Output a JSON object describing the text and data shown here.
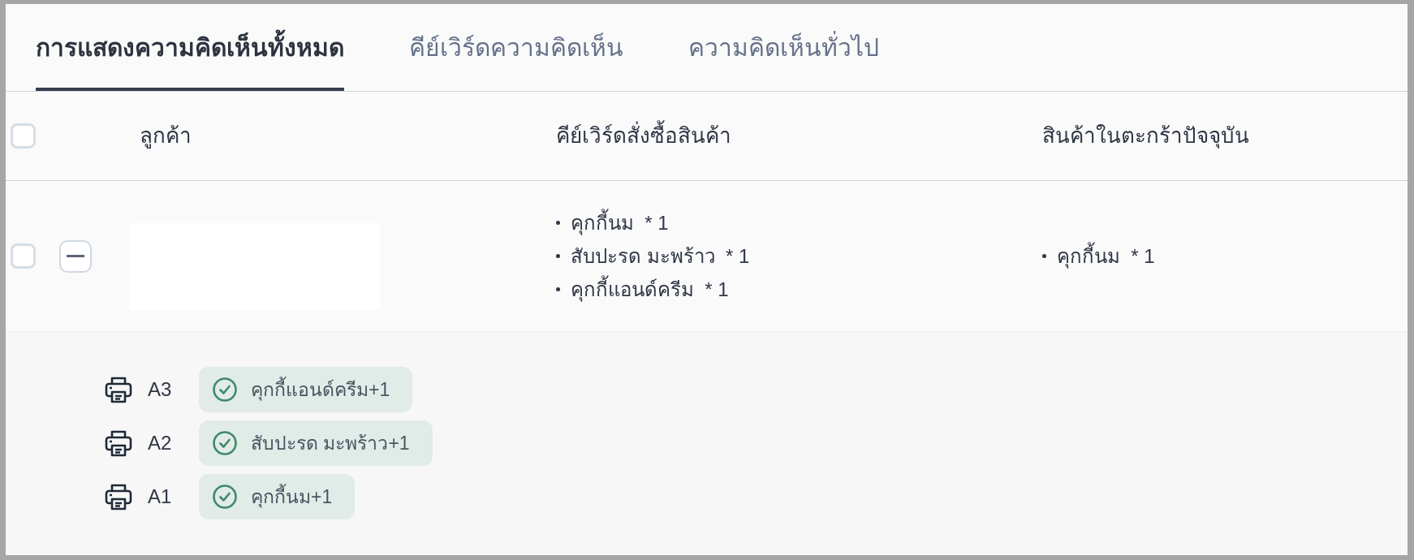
{
  "tabs": [
    {
      "label": "การแสดงความคิดเห็นทั้งหมด",
      "selected": true
    },
    {
      "label": "คีย์เวิร์ดความคิดเห็น",
      "selected": false
    },
    {
      "label": "ความคิดเห็นทั่วไป",
      "selected": false
    }
  ],
  "table": {
    "select_all": {
      "checked": false
    },
    "columns": [
      "ลูกค้า",
      "คีย์เวิร์ดสั่งซื้อสินค้า",
      "สินค้าในตะกร้าปัจจุบัน"
    ],
    "rows": [
      {
        "checked": false,
        "expanded": true,
        "order_keywords": [
          "คุกกี้นม  * 1",
          "สับปะรด มะพร้าว  * 1",
          "คุกกี้แอนด์ครีม  * 1"
        ],
        "cart_items": [
          "คุกกี้นม  * 1"
        ],
        "details": [
          {
            "printer": "A3",
            "item": "คุกกี้แอนด์ครีม+1"
          },
          {
            "printer": "A2",
            "item": "สับปะรด มะพร้าว+1"
          },
          {
            "printer": "A1",
            "item": "คุกกี้นม+1"
          }
        ]
      }
    ]
  }
}
